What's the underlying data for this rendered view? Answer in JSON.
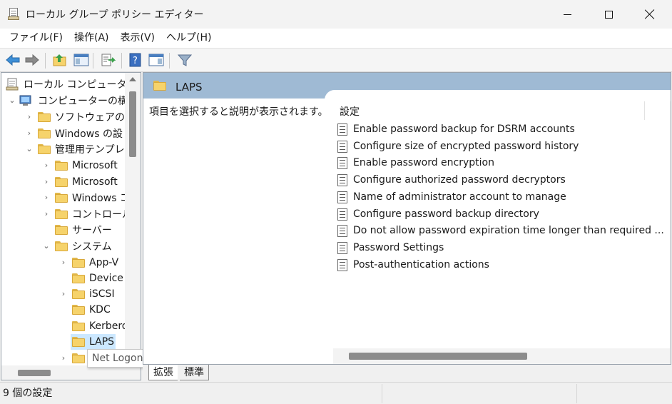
{
  "window": {
    "title": "ローカル グループ ポリシー エディター"
  },
  "menu": [
    {
      "label": "ファイル(F)"
    },
    {
      "label": "操作(A)"
    },
    {
      "label": "表示(V)"
    },
    {
      "label": "ヘルプ(H)"
    }
  ],
  "tree": {
    "root": "ローカル コンピューター ポリ",
    "computer_config": "コンピューターの構成",
    "software": "ソフトウェアの設",
    "windows_settings": "Windows の設",
    "admin_templates": "管理用テンプレ",
    "microsoft1": "Microsoft",
    "microsoft2": "Microsoft",
    "windows_comp": "Windows コ",
    "control_panel": "コントロール",
    "server": "サーバー",
    "system": "システム",
    "appv": "App-V",
    "device": "Device",
    "iscsi": "iSCSI",
    "kdc": "KDC",
    "kerberos": "Kerberos",
    "laps": "LAPS"
  },
  "tooltip": "Net Logon",
  "detail": {
    "header_title": "LAPS",
    "description": "項目を選択すると説明が表示されます。",
    "column_header": "設定",
    "settings": [
      {
        "label": "Enable password backup for DSRM accounts"
      },
      {
        "label": "Configure size of encrypted password history"
      },
      {
        "label": "Enable password encryption"
      },
      {
        "label": "Configure authorized password decryptors"
      },
      {
        "label": "Name of administrator account to manage"
      },
      {
        "label": "Configure password backup directory"
      },
      {
        "label": "Do not allow password expiration time longer than required ..."
      },
      {
        "label": "Password Settings"
      },
      {
        "label": "Post-authentication actions"
      }
    ]
  },
  "tabs": {
    "extended": "拡張",
    "standard": "標準"
  },
  "status": {
    "text": "9 個の設定"
  }
}
